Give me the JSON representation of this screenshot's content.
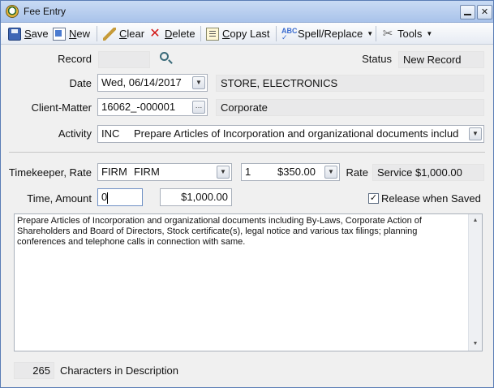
{
  "window": {
    "title": "Fee Entry"
  },
  "toolbar": {
    "save": {
      "underline": "S",
      "rest": "ave"
    },
    "new": {
      "underline": "N",
      "rest": "ew"
    },
    "clear": {
      "underline": "C",
      "rest": "lear"
    },
    "delete": {
      "underline": "D",
      "rest": "elete"
    },
    "copy_last": {
      "underline": "C",
      "rest": "opy Last"
    },
    "spell_replace": "Spell/Replace",
    "tools": "Tools"
  },
  "form": {
    "record_label": "Record",
    "record_value": "",
    "status_label": "Status",
    "status_value": "New Record",
    "date_label": "Date",
    "date_value": "Wed, 06/14/2017",
    "client_name": "STORE, ELECTRONICS",
    "client_matter_label": "Client-Matter",
    "client_matter_value": "16062_-000001",
    "matter_name": "Corporate",
    "activity_label": "Activity",
    "activity_code": "INC",
    "activity_desc": "Prepare Articles of Incorporation and organizational documents includ",
    "timekeeper_label": "Timekeeper, Rate",
    "timekeeper_code": "FIRM",
    "timekeeper_name": "FIRM",
    "rate_level": "1",
    "rate_amount": "$350.00",
    "rate_label": "Rate",
    "rate_type": "Service $1,000.00",
    "time_amount_label": "Time, Amount",
    "time_value": "0",
    "amount_value": "$1,000.00",
    "release_label": "Release when Saved",
    "release_checked": true,
    "description": "Prepare Articles of Incorporation and organizational documents including By-Laws, Corporate Action of Shareholders and Board of Directors, Stock certificate(s), legal notice and various tax filings; planning conferences and telephone calls in connection with same.",
    "char_count": "265",
    "char_count_label": "Characters in Description"
  }
}
